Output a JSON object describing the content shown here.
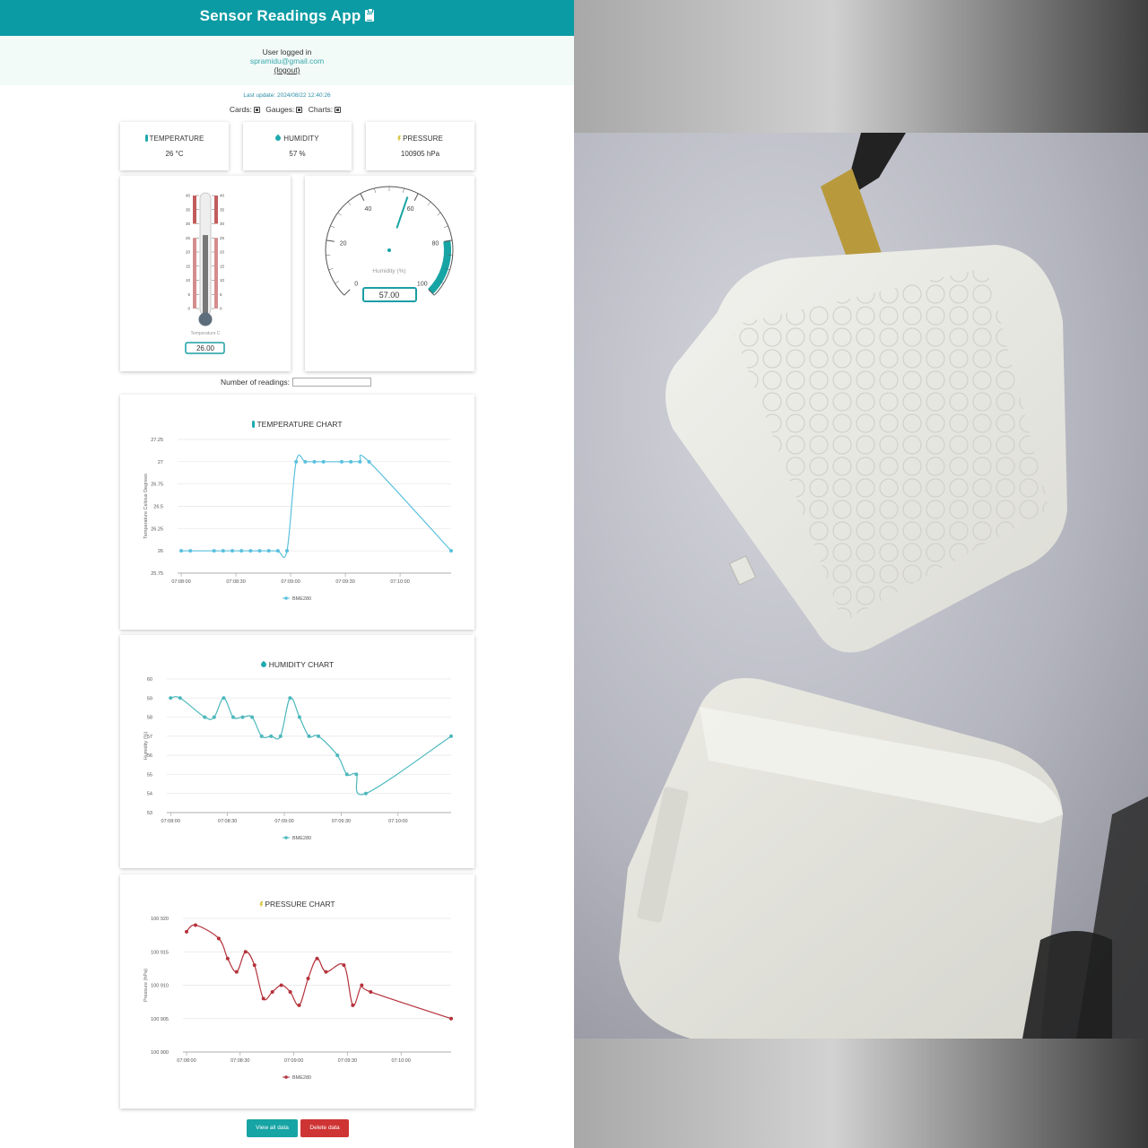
{
  "header": {
    "title": "Sensor Readings App",
    "icon": "clipboard-icon"
  },
  "user": {
    "label": "User logged in",
    "email": "spramidu@gmail.com",
    "logout": "(logout)"
  },
  "last_update": "Last update: 2024/08/22 12:40:26",
  "toggles": {
    "cards": "Cards:",
    "gauges": "Gauges:",
    "charts": "Charts:",
    "cards_checked": true,
    "gauges_checked": true,
    "charts_checked": true
  },
  "cards": {
    "temperature": {
      "title": "TEMPERATURE",
      "value": "26 °C",
      "icon": "thermometer-icon"
    },
    "humidity": {
      "title": "HUMIDITY",
      "value": "57 %",
      "icon": "water-drop-icon"
    },
    "pressure": {
      "title": "PRESSURE",
      "value": "100905 hPa",
      "icon": "lightning-icon"
    }
  },
  "gauges": {
    "thermometer": {
      "label": "Temperature C",
      "value": "26.00",
      "level": 26,
      "min": 0,
      "max": 40,
      "ticks": [
        "40",
        "35",
        "30",
        "25",
        "20",
        "15",
        "10",
        "5",
        "0"
      ]
    },
    "humidity": {
      "label": "Humidity (%)",
      "value": "57.00",
      "level": 57,
      "min": 0,
      "max": 100,
      "ticks": [
        "0",
        "20",
        "40",
        "60",
        "80",
        "100"
      ]
    }
  },
  "number_of_readings": {
    "label": "Number of readings:",
    "value": ""
  },
  "charts": {
    "temperature_title": "TEMPERATURE CHART",
    "humidity_title": "HUMIDITY CHART",
    "pressure_title": "PRESSURE CHART",
    "legend_label": "BME280"
  },
  "chart_data": [
    {
      "type": "line",
      "title": "TEMPERATURE CHART",
      "ylabel": "Temperature Celsius Degrees",
      "xlabel": "",
      "ylim": [
        25.75,
        27.25
      ],
      "yticks": [
        "27.25",
        "27",
        "26.75",
        "26.5",
        "26.25",
        "26",
        "25.75"
      ],
      "xticks": [
        "07:08:00",
        "07:08:30",
        "07:09:00",
        "07:09:30",
        "07:10:00"
      ],
      "color": "#5bc0de",
      "series": [
        {
          "name": "BME280",
          "x": [
            "07:08:00",
            "07:08:05",
            "07:08:18",
            "07:08:23",
            "07:08:28",
            "07:08:33",
            "07:08:38",
            "07:08:43",
            "07:08:48",
            "07:08:53",
            "07:08:58",
            "07:09:03",
            "07:09:08",
            "07:09:13",
            "07:09:18",
            "07:09:28",
            "07:09:33",
            "07:09:38",
            "07:09:43",
            "07:10:28"
          ],
          "values": [
            26,
            26,
            26,
            26,
            26,
            26,
            26,
            26,
            26,
            26,
            26,
            27,
            27,
            27,
            27,
            27,
            27,
            27,
            27,
            26
          ]
        }
      ]
    },
    {
      "type": "line",
      "title": "HUMIDITY CHART",
      "ylabel": "Humidity (%)",
      "xlabel": "",
      "ylim": [
        53,
        60
      ],
      "yticks": [
        "60",
        "59",
        "58",
        "57",
        "56",
        "55",
        "54",
        "53"
      ],
      "xticks": [
        "07:08:00",
        "07:08:30",
        "07:09:00",
        "07:09:30",
        "07:10:00"
      ],
      "color": "#4cb8bc",
      "series": [
        {
          "name": "BME280",
          "x": [
            "07:08:00",
            "07:08:05",
            "07:08:18",
            "07:08:23",
            "07:08:28",
            "07:08:33",
            "07:08:38",
            "07:08:43",
            "07:08:48",
            "07:08:53",
            "07:08:58",
            "07:09:03",
            "07:09:08",
            "07:09:13",
            "07:09:18",
            "07:09:28",
            "07:09:33",
            "07:09:38",
            "07:09:43",
            "07:10:28"
          ],
          "values": [
            59,
            59,
            58,
            58,
            59,
            58,
            58,
            58,
            57,
            57,
            57,
            59,
            58,
            57,
            57,
            56,
            55,
            55,
            54,
            57
          ]
        }
      ]
    },
    {
      "type": "line",
      "title": "PRESSURE CHART",
      "ylabel": "Pressure (hPa)",
      "xlabel": "",
      "ylim": [
        100900,
        100920
      ],
      "yticks": [
        "100 920",
        "100 915",
        "100 910",
        "100 905",
        "100 900"
      ],
      "xticks": [
        "07:08:00",
        "07:08:30",
        "07:09:00",
        "07:09:30",
        "07:10:00"
      ],
      "color": "#b5323c",
      "series": [
        {
          "name": "BME280",
          "x": [
            "07:08:00",
            "07:08:05",
            "07:08:18",
            "07:08:23",
            "07:08:28",
            "07:08:33",
            "07:08:38",
            "07:08:43",
            "07:08:48",
            "07:08:53",
            "07:08:58",
            "07:09:03",
            "07:09:08",
            "07:09:13",
            "07:09:18",
            "07:09:28",
            "07:09:33",
            "07:09:38",
            "07:09:43",
            "07:10:28"
          ],
          "values": [
            100918,
            100919,
            100917,
            100914,
            100912,
            100915,
            100913,
            100908,
            100909,
            100910,
            100909,
            100907,
            100911,
            100914,
            100912,
            100913,
            100907,
            100910,
            100909,
            100905
          ]
        }
      ]
    }
  ],
  "buttons": {
    "view_all": "View all data",
    "delete": "Delete data"
  }
}
